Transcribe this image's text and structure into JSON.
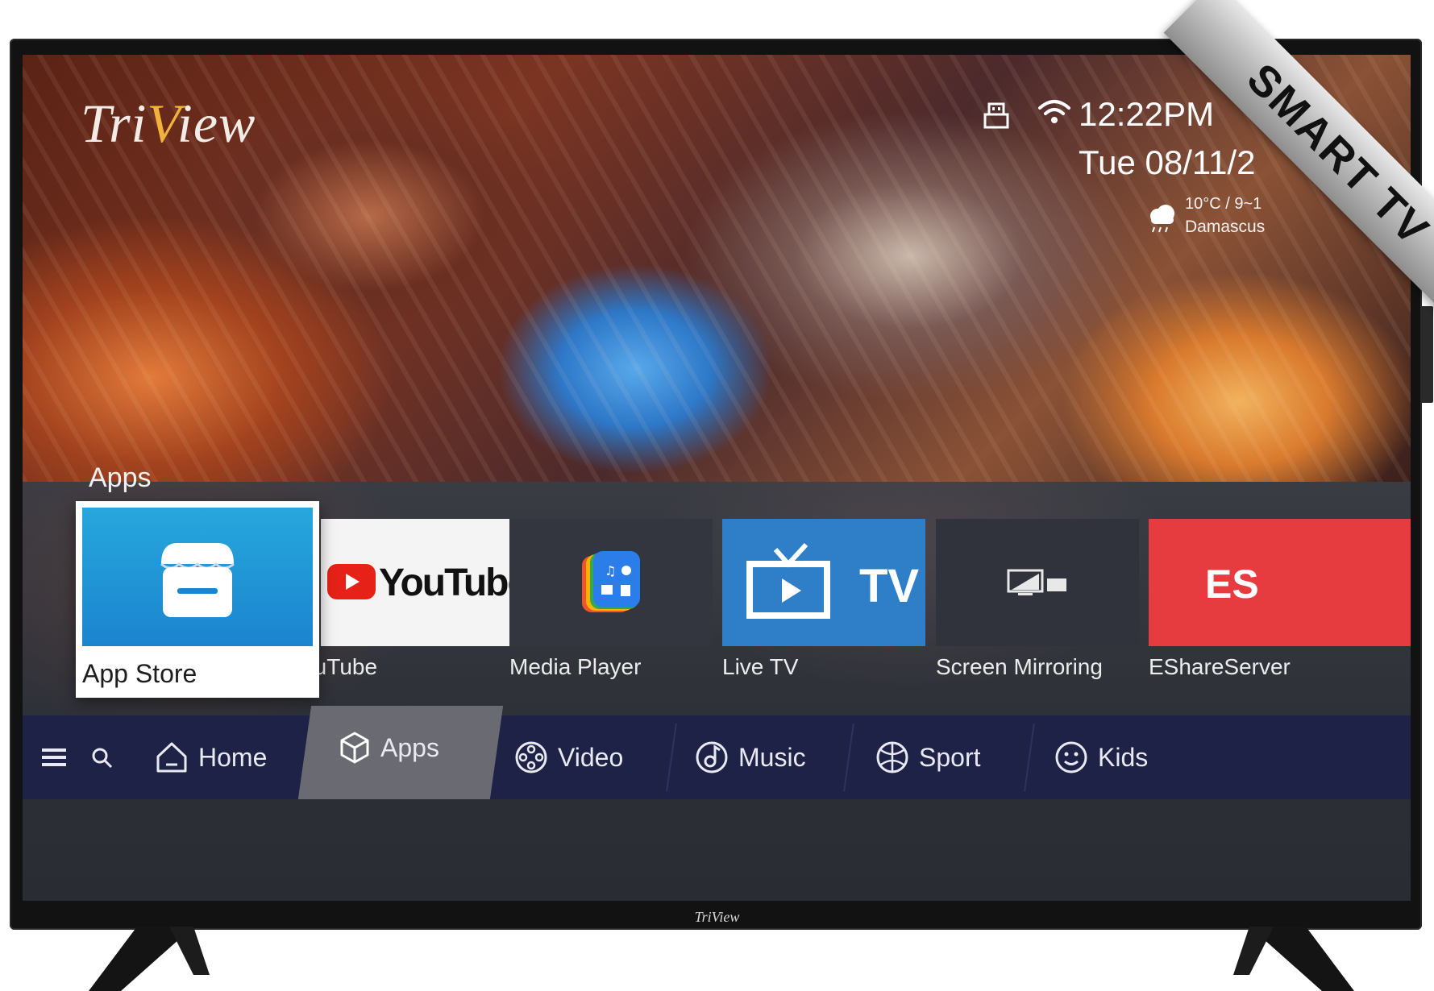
{
  "brand": {
    "name_pre": "Tri",
    "name_v": "V",
    "name_post": "iew",
    "bezel_logo": "TriView",
    "accent": "#f0b43a"
  },
  "status": {
    "time": "12:22PM",
    "date": "Tue 08/11/2",
    "weather_temp": "10°C / 9~1",
    "weather_city": "Damascus"
  },
  "ribbon": {
    "text": "SMART TV"
  },
  "section": {
    "title": "Apps"
  },
  "apps": [
    {
      "label": "App Store",
      "focused": true,
      "color": "#1b84cf"
    },
    {
      "label": "YouTube",
      "tile_text": "YouTube",
      "color": "#f4f4f4"
    },
    {
      "label": "Media Player",
      "color": "#33363f"
    },
    {
      "label": "Live TV",
      "tile_text": "TV",
      "color": "#2f7fc8"
    },
    {
      "label": "Screen Mirroring",
      "color": "#30333b"
    },
    {
      "label": "EShareServer",
      "tile_text": "ES",
      "color": "#e63b3f"
    }
  ],
  "nav": {
    "menu_icon": "hamburger-icon",
    "search_icon": "search-icon",
    "active": "Apps",
    "items": [
      {
        "label": "Home",
        "icon": "home-icon"
      },
      {
        "label": "Apps",
        "icon": "cube-icon"
      },
      {
        "label": "Video",
        "icon": "film-reel-icon"
      },
      {
        "label": "Music",
        "icon": "music-note-icon"
      },
      {
        "label": "Sport",
        "icon": "ball-icon"
      },
      {
        "label": "Kids",
        "icon": "smiley-icon"
      }
    ],
    "bar_color": "#1f2247",
    "active_color": "#6a6a72"
  }
}
